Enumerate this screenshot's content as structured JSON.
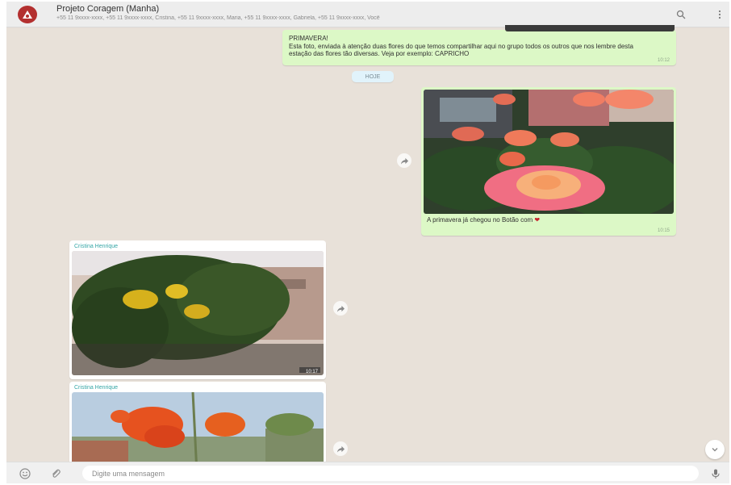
{
  "header": {
    "group_name": "Projeto Coragem (Manha)",
    "participants": "+55 11 9xxxx-xxxx, +55 11 9xxxx-xxxx, Cristina, +55 11 9xxxx-xxxx, Maria, +55 11 9xxxx-xxxx, Gabriela, +55 11 9xxxx-xxxx, Você",
    "search_icon": "search-icon",
    "menu_icon": "menu-icon"
  },
  "messages": {
    "text_message": {
      "title": "PRIMAVERA!",
      "body": "Esta foto, enviada à atenção duas flores do que temos compartilhar aqui no grupo todos os outros que nos lembre desta estação das flores tão diversas. Veja por exemplo: CAPRICHO",
      "time": "10:12"
    },
    "date_chip": "HOJE",
    "image_out": {
      "caption": "A primavera já chegou no Botão com",
      "time": "10:15"
    },
    "image_in_1": {
      "sender": "Cristina Henrique",
      "time": "10:17"
    },
    "image_in_2": {
      "sender": "Cristina Henrique"
    }
  },
  "footer": {
    "emoji_icon": "emoji-icon",
    "attach_icon": "attach-icon",
    "input_placeholder": "Digite uma mensagem",
    "mic_icon": "microphone-icon"
  },
  "colors": {
    "chat_background": "#e8e1d9",
    "outgoing_bubble": "#dcf8c6",
    "incoming_bubble": "#ffffff",
    "sender_name": "#35a6a6",
    "avatar": "#b3302f"
  }
}
